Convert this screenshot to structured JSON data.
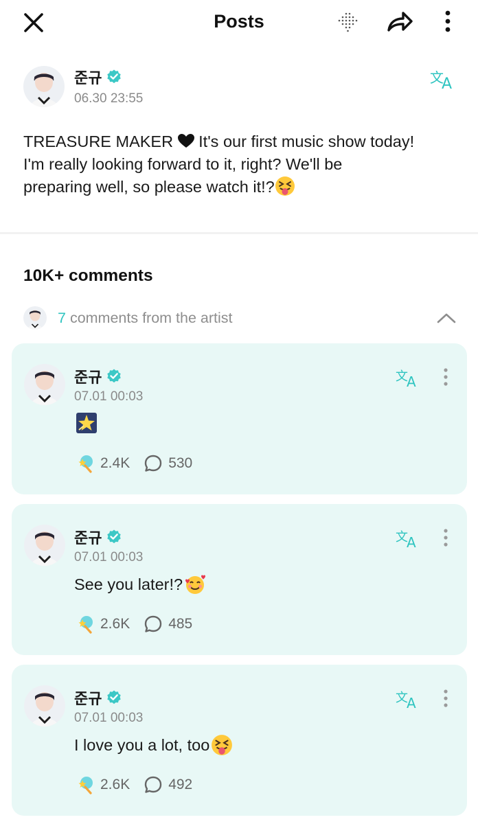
{
  "header": {
    "title": "Posts",
    "icons": [
      "close-icon",
      "dot-grid-icon",
      "share-icon",
      "more-vertical-icon"
    ]
  },
  "post": {
    "author": "준규",
    "verified": true,
    "timestamp": "06.30 23:55",
    "text": "TREASURE MAKER ♥ It's our first music show today! I'm really looking forward to it, right? We'll be preparing well, so please watch it!?",
    "text_line1": "TREASURE MAKER",
    "text_line1_rest": " It's our first music show today!",
    "text_line2": "I'm really looking forward to it, right? We'll be",
    "text_line3": "preparing well, so please watch it!?",
    "emoji": "squinting-face-with-tongue"
  },
  "comments_section": {
    "count_label": "10K+ comments",
    "artist_count": "7",
    "artist_label": " comments from the artist"
  },
  "comments": [
    {
      "author": "준규",
      "timestamp": "07.01 00:03",
      "text": "",
      "content_emoji": "glowing-star",
      "likes": "2.4K",
      "replies": "530"
    },
    {
      "author": "준규",
      "timestamp": "07.01 00:03",
      "text": "See you later!?",
      "content_emoji": "smiling-face-with-hearts",
      "likes": "2.6K",
      "replies": "485"
    },
    {
      "author": "준규",
      "timestamp": "07.01 00:03",
      "text": "I love you a lot, too",
      "content_emoji": "squinting-face-with-tongue",
      "likes": "2.6K",
      "replies": "492"
    }
  ],
  "colors": {
    "accent": "#2ec4c0",
    "card_bg": "#e8f8f6",
    "verified": "#3cc8c6"
  }
}
